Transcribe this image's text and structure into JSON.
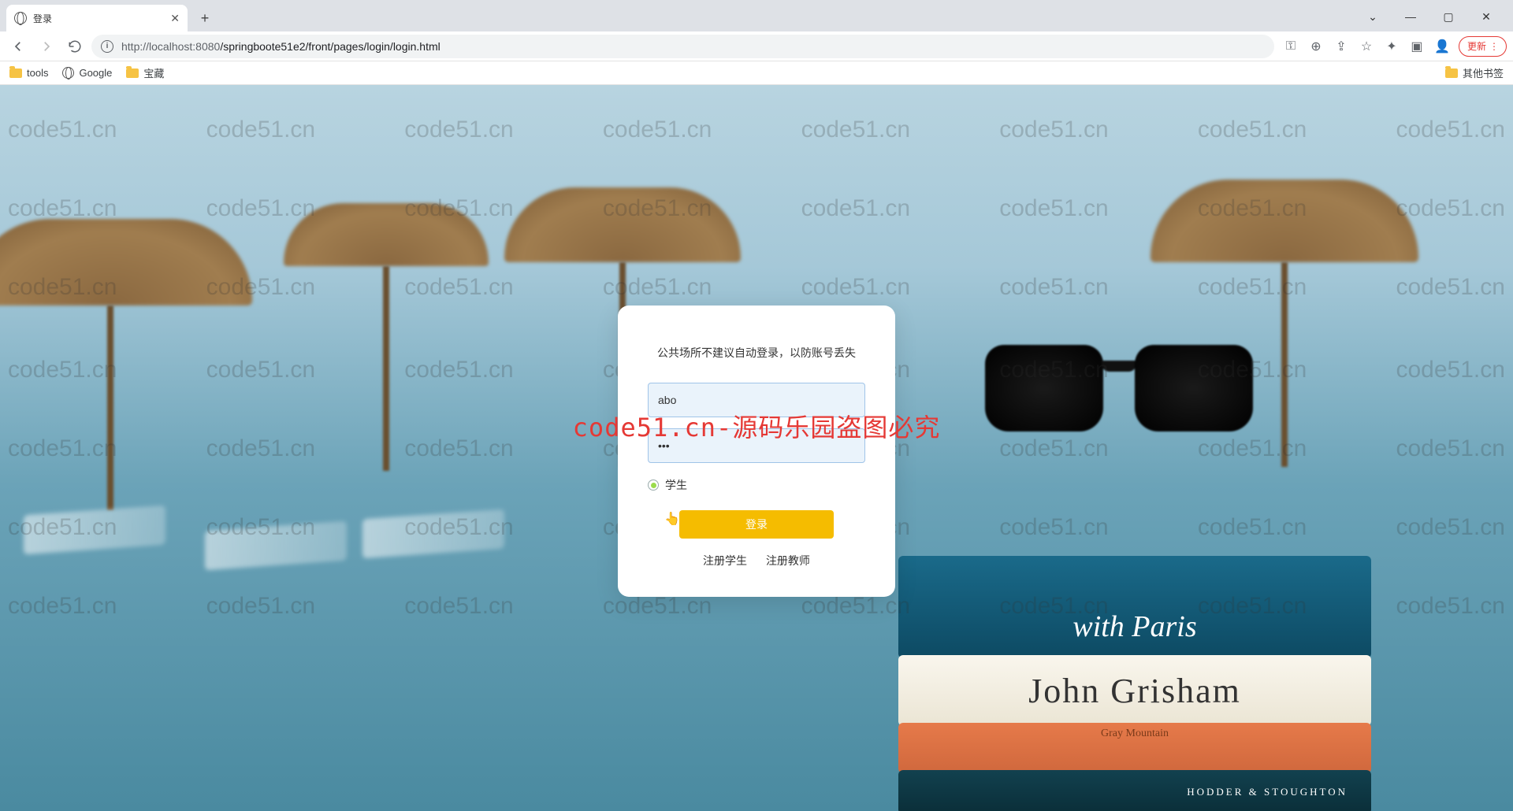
{
  "browser": {
    "tab_title": "登录",
    "url_host": "localhost:8080",
    "url_path": "/springboote51e2/front/pages/login/login.html",
    "url_display_prefix": "http://",
    "update_label": "更新",
    "window": {
      "minimize": "—",
      "maximize": "▢",
      "close": "✕"
    }
  },
  "bookmarks": {
    "items": [
      {
        "label": "tools",
        "type": "folder"
      },
      {
        "label": "Google",
        "type": "globe"
      },
      {
        "label": "宝藏",
        "type": "folder"
      }
    ],
    "other": "其他书签"
  },
  "login": {
    "notice": "公共场所不建议自动登录，以防账号丢失",
    "username_value": "abo",
    "password_value": "•••",
    "role_label": "学生",
    "submit_label": "登录",
    "register_student": "注册学生",
    "register_teacher": "注册教师"
  },
  "watermark": {
    "text": "code51.cn",
    "center": "code51.cn-源码乐园盗图必究"
  },
  "books": {
    "top": "with Paris",
    "b2": "John Grisham",
    "b3": "Gray Mountain",
    "b4": "HODDER & STOUGHTON"
  }
}
